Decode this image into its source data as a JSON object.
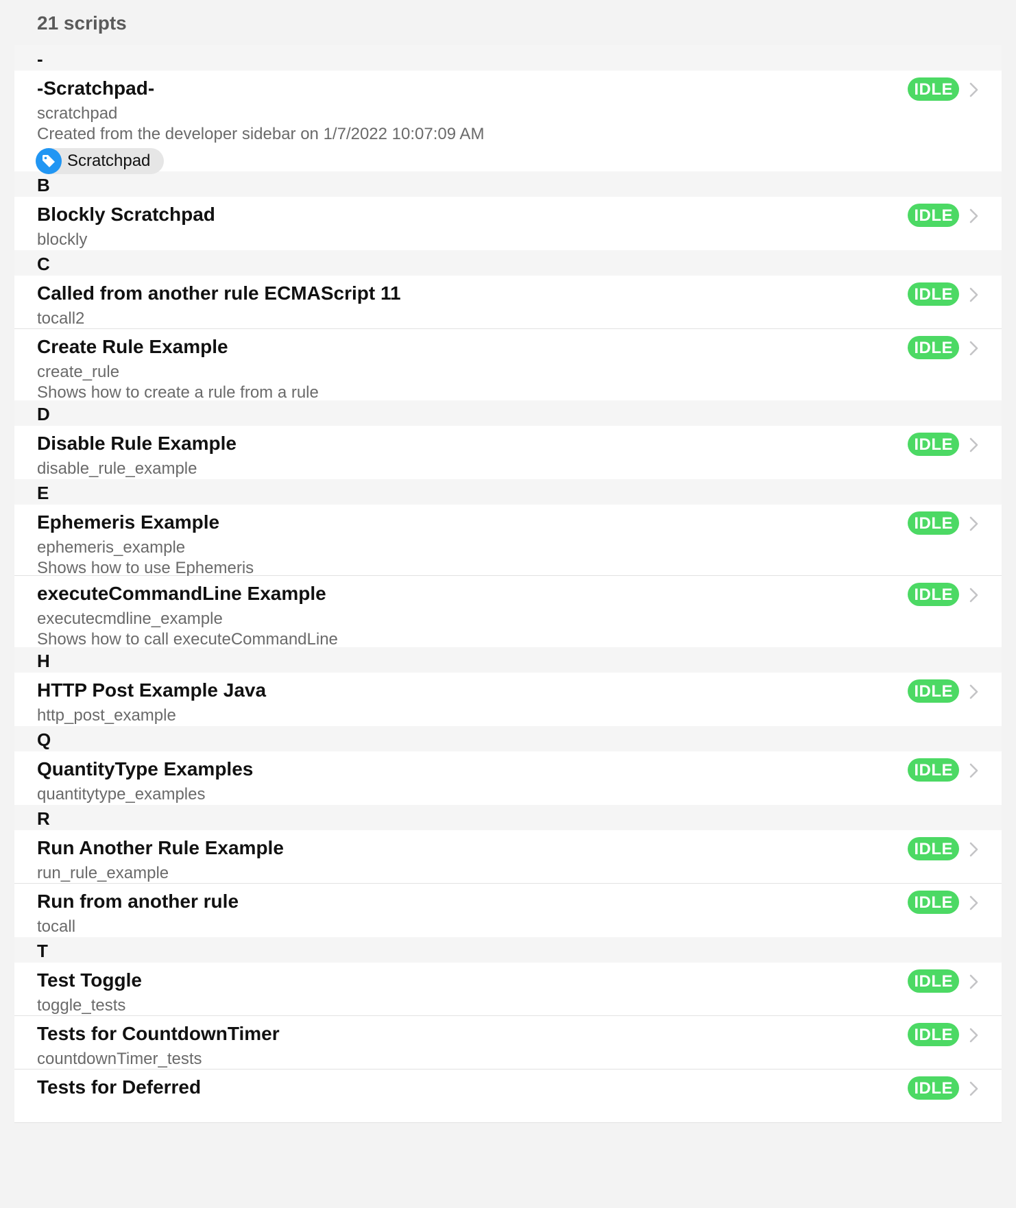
{
  "header": {
    "count_label": "21 scripts"
  },
  "colors": {
    "status_idle": "#4cd964",
    "tag_icon": "#2196f3"
  },
  "sections": [
    {
      "letter": "-",
      "items": [
        {
          "title": "-Scratchpad-",
          "uid": "scratchpad",
          "description": "Created from the developer sidebar on 1/7/2022 10:07:09 AM",
          "status": "IDLE",
          "tag": "Scratchpad",
          "tag_icon": "tag-icon"
        }
      ]
    },
    {
      "letter": "B",
      "items": [
        {
          "title": "Blockly Scratchpad",
          "uid": "blockly",
          "status": "IDLE"
        }
      ]
    },
    {
      "letter": "C",
      "items": [
        {
          "title": "Called from another rule ECMAScript 11",
          "uid": "tocall2",
          "status": "IDLE"
        },
        {
          "title": "Create Rule Example",
          "uid": "create_rule",
          "description": "Shows how to create a rule from a rule",
          "status": "IDLE"
        }
      ]
    },
    {
      "letter": "D",
      "items": [
        {
          "title": "Disable Rule Example",
          "uid": "disable_rule_example",
          "status": "IDLE"
        }
      ]
    },
    {
      "letter": "E",
      "items": [
        {
          "title": "Ephemeris Example",
          "uid": "ephemeris_example",
          "description": "Shows how to use Ephemeris",
          "status": "IDLE"
        },
        {
          "title": "executeCommandLine Example",
          "uid": "executecmdline_example",
          "description": "Shows how to call executeCommandLine",
          "status": "IDLE"
        }
      ]
    },
    {
      "letter": "H",
      "items": [
        {
          "title": "HTTP Post Example Java",
          "uid": "http_post_example",
          "status": "IDLE"
        }
      ]
    },
    {
      "letter": "Q",
      "items": [
        {
          "title": "QuantityType Examples",
          "uid": "quantitytype_examples",
          "status": "IDLE"
        }
      ]
    },
    {
      "letter": "R",
      "items": [
        {
          "title": "Run Another Rule Example",
          "uid": "run_rule_example",
          "status": "IDLE"
        },
        {
          "title": "Run from another rule",
          "uid": "tocall",
          "status": "IDLE"
        }
      ]
    },
    {
      "letter": "T",
      "items": [
        {
          "title": "Test Toggle",
          "uid": "toggle_tests",
          "status": "IDLE"
        },
        {
          "title": "Tests for CountdownTimer",
          "uid": "countdownTimer_tests",
          "status": "IDLE"
        },
        {
          "title": "Tests for Deferred",
          "status": "IDLE"
        }
      ]
    }
  ]
}
